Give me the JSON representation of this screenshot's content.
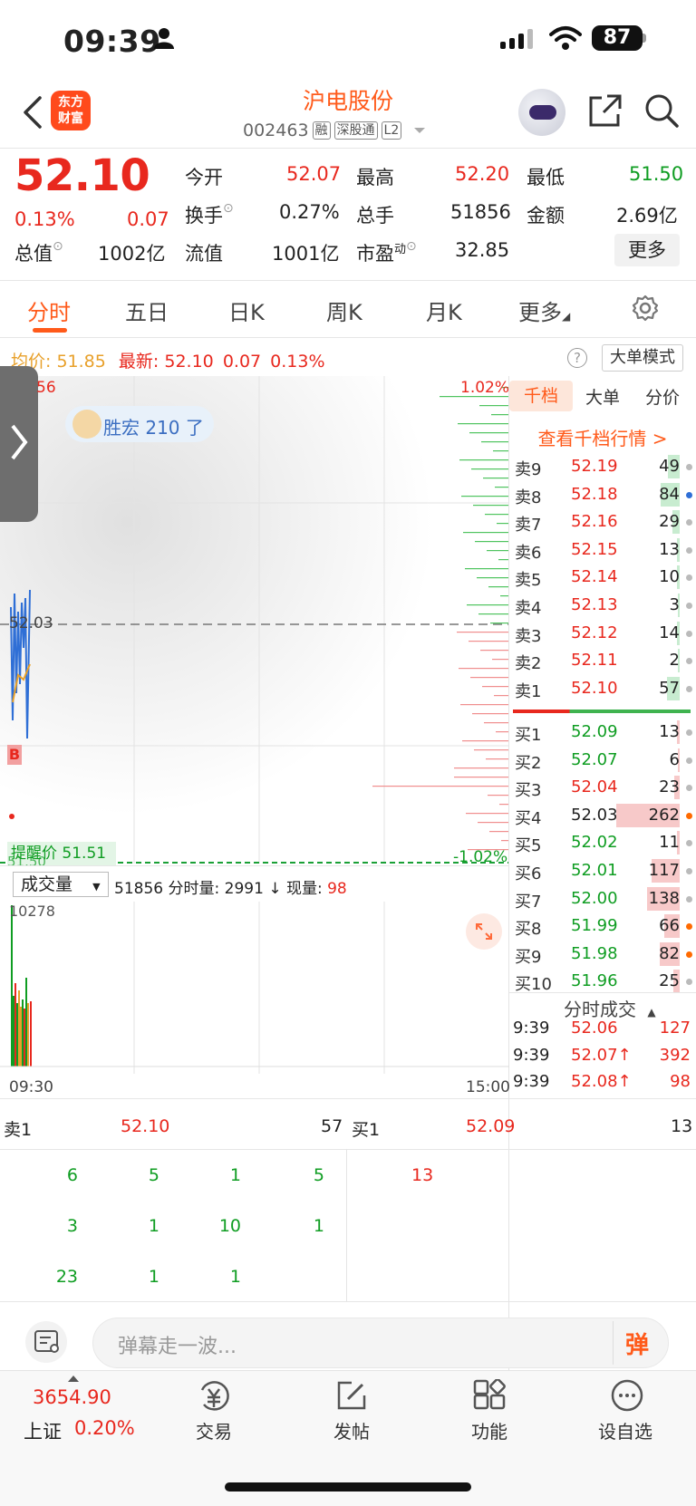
{
  "status": {
    "time": "09:39",
    "battery": "87"
  },
  "header": {
    "logo_top": "东方",
    "logo_bottom": "财富",
    "name": "沪电股份",
    "code": "002463",
    "tags": [
      "融",
      "深股通",
      "L2"
    ]
  },
  "quote": {
    "price": "52.10",
    "pct": "0.13%",
    "chg": "0.07",
    "open_label": "今开",
    "open": "52.07",
    "high_label": "最高",
    "high": "52.20",
    "low_label": "最低",
    "low": "51.50",
    "turnover_label": "换手",
    "turnover": "0.27%",
    "volume_label": "总手",
    "volume": "51856",
    "amount_label": "金额",
    "amount": "2.69亿",
    "mcap_label": "总值",
    "mcap": "1002亿",
    "float_label": "流值",
    "float": "1001亿",
    "pe_label": "市盈",
    "pe_sup": "动",
    "pe": "32.85",
    "more": "更多"
  },
  "tabs": [
    "分时",
    "五日",
    "日K",
    "周K",
    "月K",
    "更多"
  ],
  "avgline": {
    "avg_label": "均价:",
    "avg": "51.85",
    "last_label": "最新:",
    "last": "52.10",
    "chg": "0.07",
    "pct": "0.13%",
    "mode": "大单模式",
    "help": "?"
  },
  "chart": {
    "top_left": "56",
    "top_right": "1.02%",
    "bottom_right": "-1.02%",
    "prev_close": "52.03",
    "b_marker": "B",
    "bottom_left": "51.50",
    "limit_label": "提醒价 51.51",
    "bubble": "胜宏 210 了"
  },
  "orderbook": {
    "tabs": [
      "千档",
      "大单",
      "分价"
    ],
    "link": "查看千档行情 >",
    "asks": [
      {
        "label": "卖9",
        "price": "52.19",
        "vol": "49",
        "bar": 0.18,
        "dot": "#bbb"
      },
      {
        "label": "卖8",
        "price": "52.18",
        "vol": "84",
        "bar": 0.3,
        "dot": "#2f6fd6"
      },
      {
        "label": "卖7",
        "price": "52.16",
        "vol": "29",
        "bar": 0.11,
        "dot": "#bbb"
      },
      {
        "label": "卖6",
        "price": "52.15",
        "vol": "13",
        "bar": 0.05,
        "dot": "#bbb"
      },
      {
        "label": "卖5",
        "price": "52.14",
        "vol": "10",
        "bar": 0.04,
        "dot": "#bbb"
      },
      {
        "label": "卖4",
        "price": "52.13",
        "vol": "3",
        "bar": 0.02,
        "dot": "#bbb"
      },
      {
        "label": "卖3",
        "price": "52.12",
        "vol": "14",
        "bar": 0.05,
        "dot": "#bbb"
      },
      {
        "label": "卖2",
        "price": "52.11",
        "vol": "2",
        "bar": 0.01,
        "dot": "#bbb"
      },
      {
        "label": "卖1",
        "price": "52.10",
        "vol": "57",
        "bar": 0.2,
        "dot": "#bbb"
      }
    ],
    "bids": [
      {
        "label": "买1",
        "price": "52.09",
        "vol": "13",
        "bar": 0.05,
        "dot": "#bbb",
        "pcolor": "green"
      },
      {
        "label": "买2",
        "price": "52.07",
        "vol": "6",
        "bar": 0.03,
        "dot": "#bbb",
        "pcolor": "green"
      },
      {
        "label": "买3",
        "price": "52.04",
        "vol": "23",
        "bar": 0.09,
        "dot": "#bbb",
        "pcolor": "red"
      },
      {
        "label": "买4",
        "price": "52.03",
        "vol": "262",
        "bar": 1.0,
        "dot": "#ff6a00",
        "pcolor": "dark"
      },
      {
        "label": "买5",
        "price": "52.02",
        "vol": "11",
        "bar": 0.04,
        "dot": "#bbb",
        "pcolor": "green"
      },
      {
        "label": "买6",
        "price": "52.01",
        "vol": "117",
        "bar": 0.45,
        "dot": "#bbb",
        "pcolor": "green"
      },
      {
        "label": "买7",
        "price": "52.00",
        "vol": "138",
        "bar": 0.52,
        "dot": "#bbb",
        "pcolor": "green"
      },
      {
        "label": "买8",
        "price": "51.99",
        "vol": "66",
        "bar": 0.25,
        "dot": "#ff6a00",
        "pcolor": "green"
      },
      {
        "label": "买9",
        "price": "51.98",
        "vol": "82",
        "bar": 0.31,
        "dot": "#ff6a00",
        "pcolor": "green"
      },
      {
        "label": "买10",
        "price": "51.96",
        "vol": "25",
        "bar": 0.1,
        "dot": "#bbb",
        "pcolor": "green"
      }
    ],
    "ts_header": "分时成交",
    "ticks": [
      {
        "time": "9:39",
        "price": "52.06",
        "vol": "127"
      },
      {
        "time": "9:39",
        "price": "52.07↑",
        "vol": "392"
      },
      {
        "time": "9:39",
        "price": "52.08↑",
        "vol": "98"
      }
    ]
  },
  "volume": {
    "selector": "成交量",
    "total": "51856",
    "minute_label": "分时量:",
    "minute": "2991",
    "arrow": "↓",
    "now_label": "现量:",
    "now": "98",
    "max": "10278",
    "start": "09:30",
    "end": "15:00"
  },
  "book_table": {
    "ask_label": "卖1",
    "ask_price": "52.10",
    "ask_vol": "57",
    "bid_label": "买1",
    "bid_price": "52.09",
    "bid_vol": "13",
    "ask_rows": [
      [
        "6",
        "5",
        "1",
        "5"
      ],
      [
        "3",
        "1",
        "10",
        "1"
      ],
      [
        "23",
        "1",
        "1",
        ""
      ]
    ],
    "bid_rows": [
      [
        "13"
      ],
      [],
      []
    ]
  },
  "comment": {
    "placeholder": "弹幕走一波...",
    "danmu": "弹"
  },
  "nav": {
    "index_value": "3654.90",
    "index_name": "上证",
    "index_pct": "0.20%",
    "items": [
      "交易",
      "发帖",
      "功能",
      "设自选"
    ]
  }
}
